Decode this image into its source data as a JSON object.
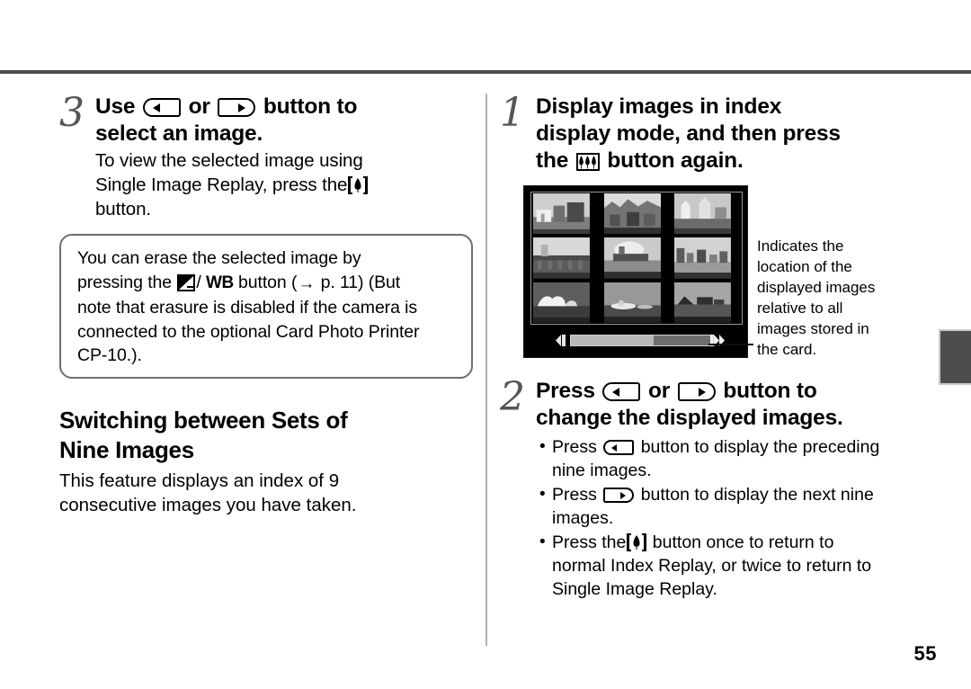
{
  "page": {
    "number": "55"
  },
  "left_column": {
    "step": {
      "number": "3",
      "title_part1": "Use",
      "title_button_left": "left-arrow-button",
      "title_or": "or",
      "title_button_right": "right-arrow-button",
      "title_part2": "button to",
      "title_line2": "select an image.",
      "sub_part1": "To view the selected image using",
      "sub_part2": "Single Image Replay, press the",
      "sub_icon": "tele-single-tree-icon",
      "sub_part3": "button."
    },
    "note_box": {
      "line1": "You can erase the selected image by",
      "line2_pre": "pressing the",
      "icon_exposure": "exposure-compensation-icon",
      "slash": "/",
      "label_wb": "WB",
      "line2_mid": "button (",
      "arrow": "→",
      "page_ref": "p. 11",
      "line2_post": ") (But",
      "line3": "note that erasure is disabled if the camera is",
      "line4": "connected to the optional Card Photo Printer",
      "line5": "CP-10.)."
    },
    "section": {
      "heading_line1": "Switching between Sets of",
      "heading_line2": "Nine Images",
      "body_line1": "This feature displays an index of 9",
      "body_line2": "consecutive images you have taken."
    }
  },
  "right_column": {
    "step1": {
      "number": "1",
      "title_line1": "Display images in index",
      "title_line2": "display mode, and then press",
      "title_line3_pre": "the",
      "title_icon": "wide-three-trees-icon",
      "title_line3_post": "button again."
    },
    "illustration": {
      "lcd_label": "camera-lcd-index-display",
      "scrollbar_label": "position-indicator-scrollbar",
      "scroll_position_percent": 58,
      "annotation_lines": [
        "Indicates the",
        "location of the",
        "displayed images",
        "relative to all",
        "images stored in",
        "the card."
      ]
    },
    "step2": {
      "number": "2",
      "title_part1": "Press",
      "title_or": "or",
      "title_part2": "button to",
      "title_line2": "change the displayed images.",
      "bullets": [
        {
          "dot": "•",
          "pre": "Press",
          "button": "left-arrow-button",
          "post": "button to display the preceding",
          "cont": "nine images."
        },
        {
          "dot": "•",
          "pre": "Press",
          "button": "right-arrow-button",
          "post": "button to display the next nine",
          "cont": "images."
        },
        {
          "dot": "•",
          "pre": "Press the",
          "button": "tele-single-tree-icon",
          "post": "button once to return to",
          "cont": "normal Index Replay, or twice to return to",
          "cont2": "Single Image Replay."
        }
      ]
    }
  },
  "colors": {
    "rule": "#4d4d4d",
    "divider": "#b0b0b0",
    "note_border": "#6f6f6f",
    "edge_tab": "#4d4d4d",
    "lcd_background": "#000000",
    "scroll_thumb": "#b9b9b9",
    "scroll_track": "#6e6e6e"
  }
}
